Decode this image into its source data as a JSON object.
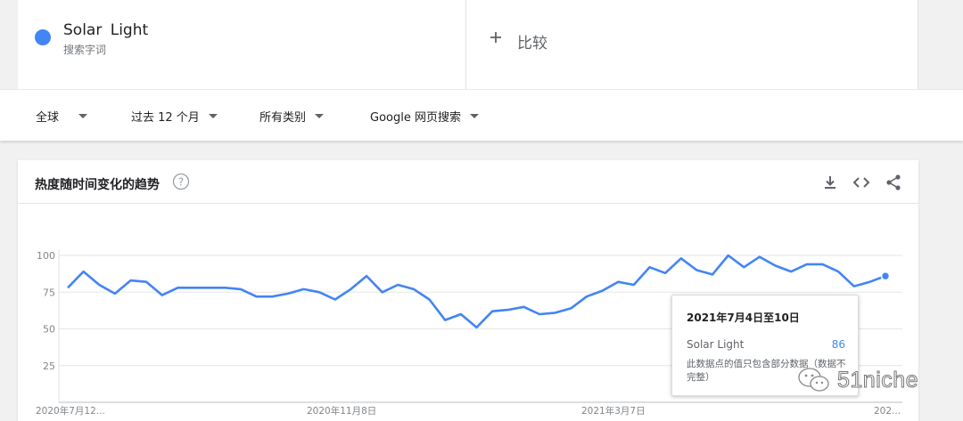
{
  "search_term": {
    "name": "Solar Light",
    "subtitle": "搜索字词",
    "dot_color": "#4285f4"
  },
  "compare": {
    "label": "比较",
    "icon": "plus-icon"
  },
  "filters": [
    {
      "label": "全球"
    },
    {
      "label": "过去 12 个月"
    },
    {
      "label": "所有类别"
    },
    {
      "label": "Google 网页搜索"
    }
  ],
  "trend": {
    "title": "热度随时间变化的趋势",
    "tools": [
      "download-icon",
      "embed-code-icon",
      "share-icon"
    ]
  },
  "chart_data": {
    "type": "line",
    "line_color": "#4285f4",
    "ylim": [
      0,
      100
    ],
    "yticks": [
      "25",
      "50",
      "75",
      "100"
    ],
    "xticks": [
      "2020年7月12...",
      "2020年11月8日",
      "2021年3月7日",
      "202..."
    ],
    "grid": true,
    "series": [
      {
        "name": "Solar Light",
        "values": [
          78,
          89,
          80,
          74,
          83,
          82,
          73,
          78,
          78,
          78,
          78,
          77,
          72,
          72,
          74,
          77,
          75,
          70,
          77,
          86,
          75,
          80,
          77,
          70,
          56,
          60,
          51,
          62,
          63,
          65,
          60,
          61,
          64,
          72,
          76,
          82,
          80,
          92,
          88,
          98,
          90,
          87,
          100,
          92,
          99,
          93,
          89,
          94,
          94,
          89,
          79,
          82,
          86
        ]
      }
    ]
  },
  "tooltip": {
    "date": "2021年7月4日至10日",
    "series_name": "Solar Light",
    "value": "86",
    "note": "此数据点的值只包含部分数据（数据不完整）"
  },
  "watermark": {
    "text": "51niche",
    "icon": "wechat-icon"
  }
}
